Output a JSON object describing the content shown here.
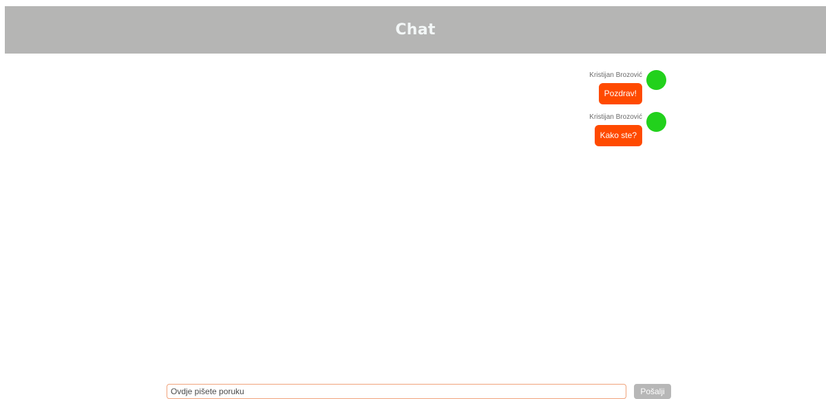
{
  "header": {
    "title": "Chat"
  },
  "messages": [
    {
      "author": "Kristijan Brozović",
      "text": "Pozdrav!"
    },
    {
      "author": "Kristijan Brozović",
      "text": "Kako ste?"
    }
  ],
  "composer": {
    "placeholder": "Ovdje pišete poruku",
    "value": "",
    "send_label": "Pošalji"
  },
  "colors": {
    "header_bg": "#b5b5b4",
    "bubble_bg": "#ff4a00",
    "avatar": "#22d11c",
    "send_button_bg": "#b7b7b7",
    "input_border": "#f0a27a"
  }
}
